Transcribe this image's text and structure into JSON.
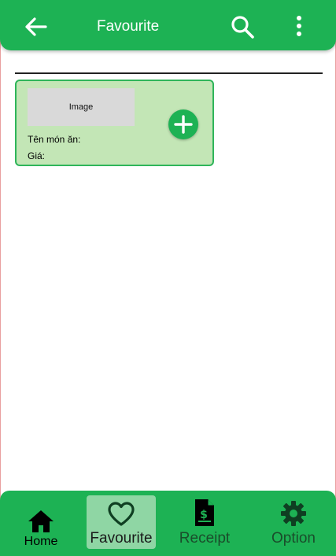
{
  "appbar": {
    "title": "Favourite",
    "back_icon": "arrow-left-icon",
    "search_icon": "search-icon",
    "more_icon": "more-vertical-icon"
  },
  "favourite_items": [
    {
      "image_placeholder": "Image",
      "name_label": "Tên món ăn:",
      "price_label": "Giá:",
      "add_icon": "plus-circle-icon"
    }
  ],
  "bottom_nav": {
    "items": [
      {
        "label": "Home",
        "icon": "home-icon",
        "active": false
      },
      {
        "label": "Favourite",
        "icon": "heart-icon",
        "active": true
      },
      {
        "label": "Receipt",
        "icon": "receipt-icon",
        "active": false
      },
      {
        "label": "Option",
        "icon": "gear-icon",
        "active": false
      }
    ]
  },
  "colors": {
    "primary": "#1db254",
    "card_bg": "#c3e6b6",
    "active_tab_bg": "#8fd6a4"
  }
}
